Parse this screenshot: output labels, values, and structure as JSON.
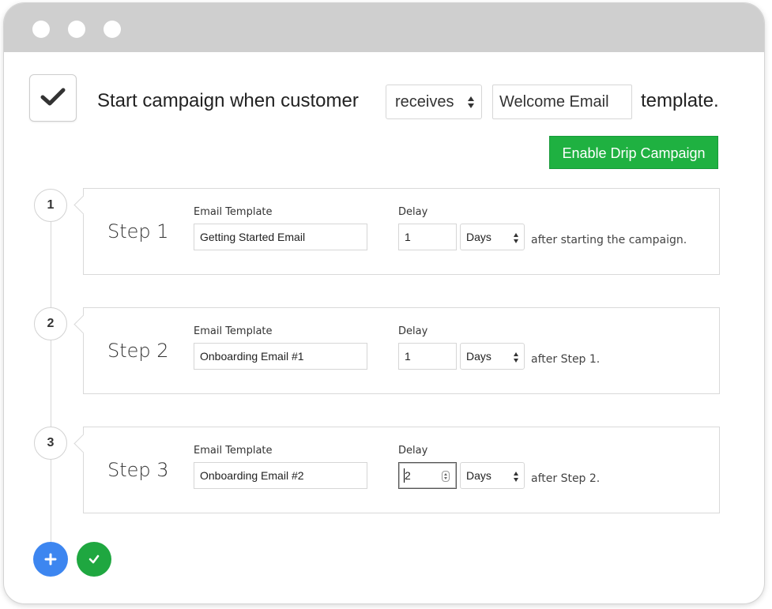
{
  "window": {
    "controls": [
      "window-dot",
      "window-dot",
      "window-dot"
    ]
  },
  "header": {
    "checkbox_checked": true,
    "text_before": "Start campaign when customer",
    "trigger_select": "receives",
    "template_value": "Welcome Email",
    "text_after": "template."
  },
  "enable_button": {
    "label": "Enable Drip Campaign",
    "color": "#1fb141"
  },
  "steps": [
    {
      "number": "1",
      "title": "Step 1",
      "template_label": "Email Template",
      "template_value": "Getting Started Email",
      "delay_label": "Delay",
      "delay_value": "1",
      "delay_unit": "Days",
      "after_text": "after starting the campaign."
    },
    {
      "number": "2",
      "title": "Step 2",
      "template_label": "Email Template",
      "template_value": "Onboarding Email #1",
      "delay_label": "Delay",
      "delay_value": "1",
      "delay_unit": "Days",
      "after_text": "after Step 1."
    },
    {
      "number": "3",
      "title": "Step 3",
      "template_label": "Email Template",
      "template_value": "Onboarding Email #2",
      "delay_label": "Delay",
      "delay_value": "2",
      "delay_unit": "Days",
      "after_text": "after Step 2."
    }
  ],
  "actions": {
    "add_icon": "plus-icon",
    "add_color": "#3d86f0",
    "save_icon": "check-icon",
    "save_color": "#1fa740"
  }
}
